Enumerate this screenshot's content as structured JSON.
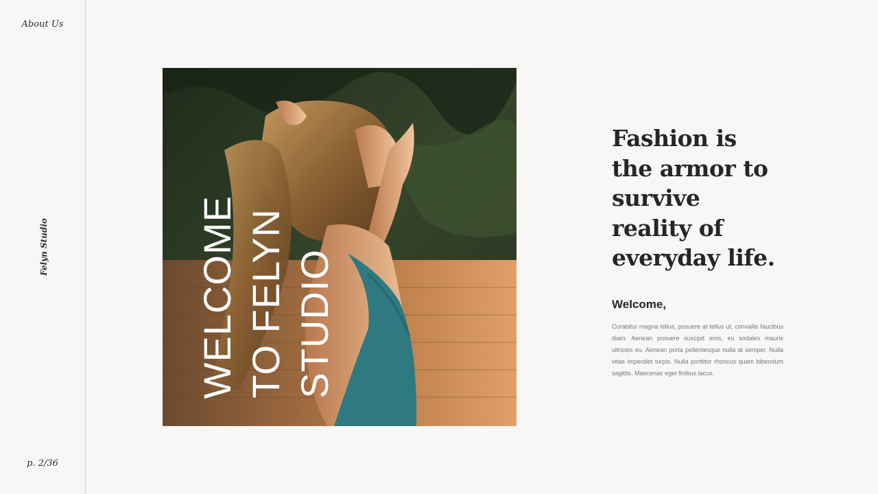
{
  "sidebar": {
    "top_link": "About Us",
    "brand": "Felyn Studio",
    "page_number": "p. 2/36"
  },
  "hero": {
    "lines": [
      "WELCOME",
      "TO FELYN",
      "STUDIO"
    ],
    "image_description_icon": "photo-woman-profile"
  },
  "content": {
    "headline": "Fashion is the armor to survive reality of everyday life.",
    "welcome": "Welcome,",
    "body": "Curabitur magna tellus, posuere at tellus ut, convallis faucibus diam. Aenean posuere suscipit eros, eu sodales mauris ultricies eu. Aenean porta pellentesque nulla at semper. Nulla vitae imperdiet turpis. Nulla porttitor rhoncus quam bibendum sagittis. Maecenas eget finibus lacus."
  },
  "colors": {
    "background": "#f8f7f5",
    "text_dark": "#262626",
    "text_muted": "#777777",
    "divider": "#d9d6d1"
  }
}
